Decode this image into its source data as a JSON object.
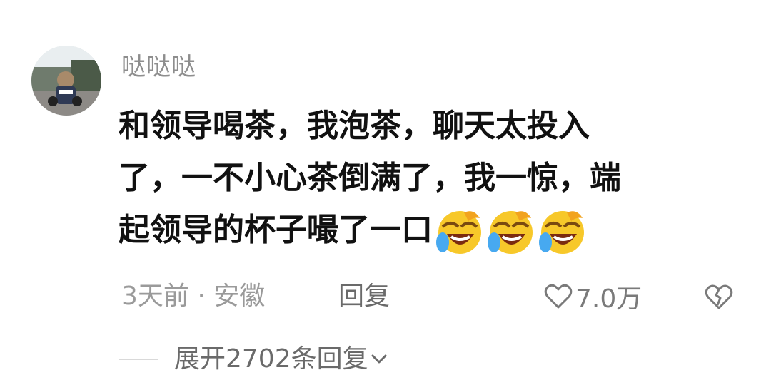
{
  "comment": {
    "username": "哒哒哒",
    "avatar_icon": "avatar-photo",
    "text_lines": [
      "和领导喝茶，我泡茶，聊天太投入",
      "了，一不小心茶倒满了，我一惊，端",
      "起领导的杯子嘬了一口"
    ],
    "emojis": [
      "laughing-crying-emoji",
      "laughing-crying-emoji",
      "laughing-crying-emoji"
    ],
    "time_location": "3天前 · 安徽",
    "reply_label": "回复",
    "like_icon": "heart-outline-icon",
    "like_count": "7.0万",
    "dislike_icon": "broken-heart-icon"
  },
  "replies": {
    "expand_label": "展开2702条回复",
    "expand_icon": "chevron-down-icon"
  },
  "colors": {
    "username": "#8e8e8e",
    "body_text": "#111111",
    "meta_text": "#9a9a9a",
    "emoji_face": "#f7c82a",
    "emoji_tear": "#47a9f0"
  }
}
